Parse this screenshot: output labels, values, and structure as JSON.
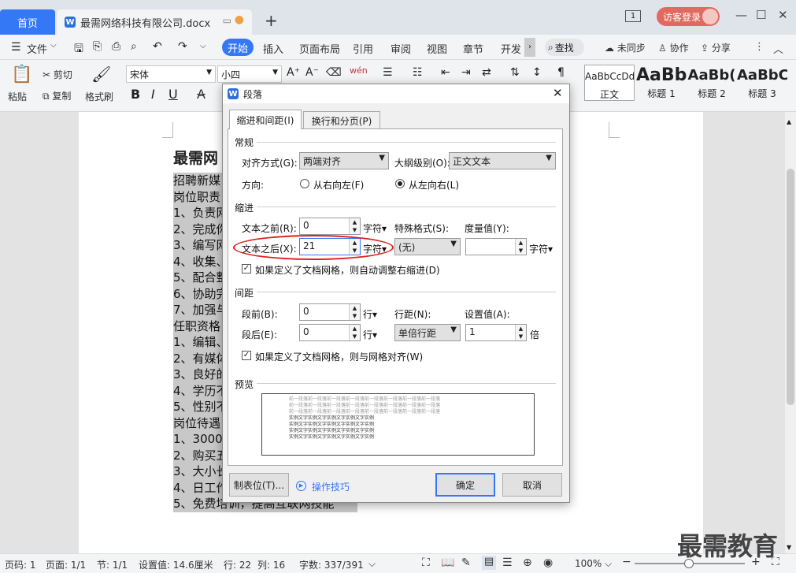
{
  "titlebar": {
    "home_tab": "首页",
    "doc_tab": "最需网络科技有限公司.docx",
    "page_num": "1",
    "guest_login": "访客登录"
  },
  "menu": {
    "file": "文件",
    "items": [
      "开始",
      "插入",
      "页面布局",
      "引用",
      "审阅",
      "视图",
      "章节",
      "开发"
    ],
    "search": "查找",
    "sync": "未同步",
    "collab": "协作",
    "share": "分享"
  },
  "ribbon": {
    "paste": "粘贴",
    "cut": "剪切",
    "copy": "复制",
    "format_painter": "格式刷",
    "font_name": "宋体",
    "font_size": "小四",
    "styles": [
      {
        "preview": "AaBbCcDd",
        "name": "正文"
      },
      {
        "preview": "AaBb",
        "name": "标题 1"
      },
      {
        "preview": "AaBb(",
        "name": "标题 2"
      },
      {
        "preview": "AaBbC",
        "name": "标题 3"
      }
    ]
  },
  "document": {
    "title": "最需网",
    "lines": [
      "招聘新媒",
      "岗位职责",
      "1、负责网",
      "2、完成你",
      "3、编写网",
      "4、收集、",
      "5、配合整",
      "6、协助完",
      "7、加强与",
      "任职资格",
      "1、编辑、",
      "2、有媒体",
      "3、良好的",
      "4、学历不",
      "5、性别不",
      "岗位待遇",
      "1、3000",
      "2、购买五",
      "3、大小长",
      "4、日工作",
      "5、免费培训，提高互联网技能"
    ]
  },
  "dialog": {
    "title": "段落",
    "tabs": [
      "缩进和间距(I)",
      "换行和分页(P)"
    ],
    "general": {
      "heading": "常规",
      "align_label": "对齐方式(G):",
      "align_value": "两端对齐",
      "outline_label": "大纲级别(O):",
      "outline_value": "正文文本",
      "direction_label": "方向:",
      "rtl": "从右向左(F)",
      "ltr": "从左向右(L)"
    },
    "indent": {
      "heading": "缩进",
      "before_label": "文本之前(R):",
      "before_value": "0",
      "after_label": "文本之后(X):",
      "after_value": "21",
      "unit": "字符",
      "special_label": "特殊格式(S):",
      "special_value": "(无)",
      "amount_label": "度量值(Y):",
      "amount_value": "",
      "amount_unit": "字符",
      "auto_adjust": "如果定义了文档网格，则自动调整右缩进(D)"
    },
    "spacing": {
      "heading": "间距",
      "before_label": "段前(B):",
      "before_value": "0",
      "before_unit": "行",
      "after_label": "段后(E):",
      "after_value": "0",
      "after_unit": "行",
      "line_label": "行距(N):",
      "line_value": "单倍行距",
      "set_label": "设置值(A):",
      "set_value": "1",
      "set_unit": "倍",
      "snap_grid": "如果定义了文档网格，则与网格对齐(W)"
    },
    "preview_heading": "预览",
    "preview_prev": "前一段落前一段落前一段落前一段落前一段落前一段落前一段落前一段落",
    "preview_sample": "实例文字实例文字实例文字实例文字实例",
    "tabs_button": "制表位(T)...",
    "tips": "操作技巧",
    "ok": "确定",
    "cancel": "取消"
  },
  "status": {
    "page_code": "页码: 1",
    "page": "页面: 1/1",
    "section": "节: 1/1",
    "setting": "设置值: 14.6厘米",
    "row": "行: 22",
    "col": "列: 16",
    "words": "字数: 337/391",
    "zoom": "100%"
  },
  "watermark": "最需教育",
  "colors": {
    "accent": "#3478f6",
    "guest": "#e2695f",
    "highlight": "#e02020"
  }
}
